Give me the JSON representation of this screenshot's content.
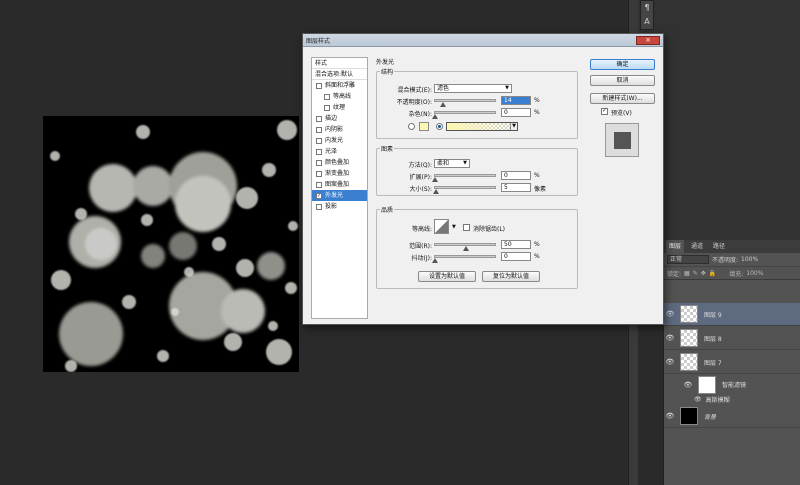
{
  "dialog": {
    "title": "图层样式",
    "close_symbol": "×"
  },
  "style_list": {
    "header": "样式",
    "blend_options": "混合选项:默认",
    "items": [
      {
        "label": "斜面和浮雕",
        "checked": false
      },
      {
        "label": "等高线",
        "checked": false
      },
      {
        "label": "纹理",
        "checked": false
      },
      {
        "label": "描边",
        "checked": false
      },
      {
        "label": "内阴影",
        "checked": false
      },
      {
        "label": "内发光",
        "checked": false
      },
      {
        "label": "光泽",
        "checked": false
      },
      {
        "label": "颜色叠加",
        "checked": false
      },
      {
        "label": "渐变叠加",
        "checked": false
      },
      {
        "label": "图案叠加",
        "checked": false
      },
      {
        "label": "外发光",
        "checked": true,
        "selected": true
      },
      {
        "label": "投影",
        "checked": false
      }
    ]
  },
  "outer_glow": {
    "title": "外发光",
    "structure": {
      "title": "结构",
      "blend_mode_label": "混合模式(E):",
      "blend_mode_value": "滤色",
      "opacity_label": "不透明度(O):",
      "opacity_value": "14",
      "noise_label": "杂色(N):",
      "noise_value": "0",
      "percent": "%",
      "glow_color": "#fdf7b4"
    },
    "elements": {
      "title": "图素",
      "technique_label": "方法(Q):",
      "technique_value": "柔和",
      "spread_label": "扩展(P):",
      "spread_value": "0",
      "size_label": "大小(S):",
      "size_value": "5",
      "px_unit": "像素",
      "percent": "%"
    },
    "quality": {
      "title": "品质",
      "contour_label": "等高线:",
      "anti_alias_label": "消除锯齿(L)",
      "range_label": "范围(R):",
      "range_value": "50",
      "jitter_label": "抖动(J):",
      "jitter_value": "0",
      "percent": "%"
    },
    "make_default": "设置为默认值",
    "reset_default": "复位为默认值"
  },
  "buttons": {
    "ok": "确定",
    "cancel": "取消",
    "new_style": "新建样式(W)...",
    "preview_label": "预览(V)"
  },
  "layers_panel": {
    "tabs": [
      "图层",
      "通道",
      "路径"
    ],
    "blend_mode": "正常",
    "opacity_label": "不透明度:",
    "opacity_value": "100%",
    "lock_label": "锁定:",
    "fill_label": "填充:",
    "fill_value": "100%",
    "layers": [
      {
        "name": "图层 9",
        "selected": true
      },
      {
        "name": "图层 8",
        "selected": false
      },
      {
        "name": "图层 7",
        "selected": false
      },
      {
        "name": "智能滤镜",
        "selected": false
      },
      {
        "name": "高斯模糊",
        "selected": false
      },
      {
        "name": "背景",
        "selected": false
      }
    ]
  },
  "colors": {
    "accent": "#3b7fd0",
    "selected_layer": "#5e6a80",
    "glow_yellow": "#fdf7b4"
  }
}
